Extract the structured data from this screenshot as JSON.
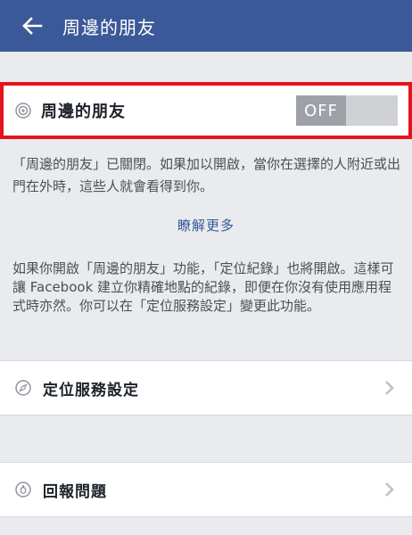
{
  "appbar": {
    "title": "周邊的朋友",
    "back_icon": "arrow-left-icon",
    "background": "#3b5998"
  },
  "nearby_toggle": {
    "label": "周邊的朋友",
    "state_text": "OFF",
    "enabled": false,
    "icon": "radar-icon",
    "highlight_color": "#e4131c"
  },
  "description": {
    "status_text": "「周邊的朋友」已關閉。如果加以開啟，當你在選擇的人附近或出門在外時，這些人就會看得到你。",
    "learn_more": "瞭解更多",
    "history_text": "如果你開啟「周邊的朋友」功能，「定位紀錄」也將開啟。這樣可讓 Facebook 建立你精確地點的紀錄，即便在你沒有使用應用程式時亦然。你可以在「定位服務設定」變更此功能。"
  },
  "menu": {
    "location_settings": {
      "label": "定位服務設定",
      "icon": "compass-icon"
    },
    "report_problem": {
      "label": "回報問題",
      "icon": "bug-icon"
    }
  }
}
